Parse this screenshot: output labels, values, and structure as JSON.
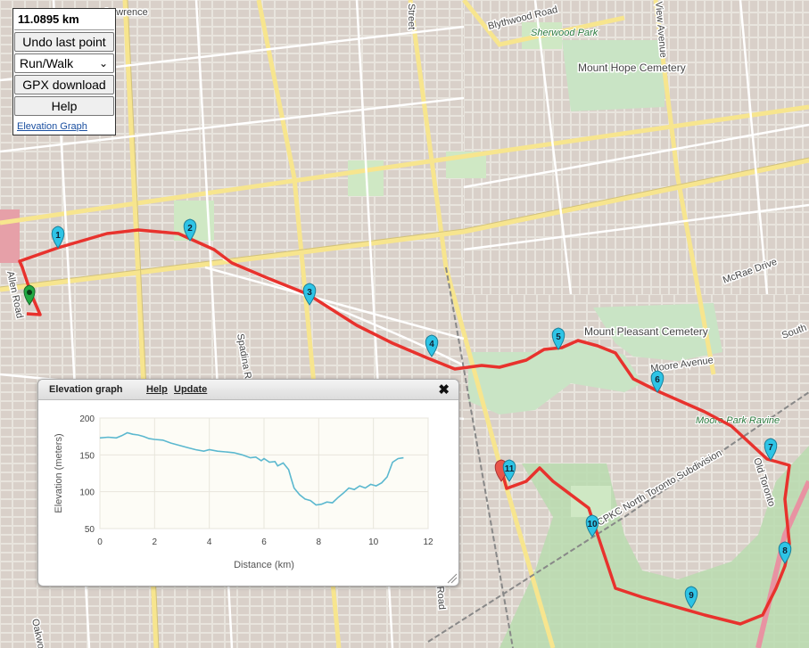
{
  "panel": {
    "distance": "11.0895 km",
    "undo_label": "Undo last point",
    "mode_selected": "Run/Walk",
    "gpx_label": "GPX download",
    "help_label": "Help",
    "elevation_link": "Elevation Graph"
  },
  "map": {
    "street_labels": [
      "Blythwood Road",
      "Spadina Road",
      "Allen Road",
      "McRae Drive",
      "Moore Avenue",
      "CPKC North Toronto Subdivision",
      "Oakwood",
      "Old Toronto",
      "South"
    ],
    "park_labels": [
      "Sherwood Park",
      "Mount Hope Cemetery",
      "Mount Pleasant Cemetery",
      "Moore Park Ravine"
    ],
    "partial_labels": [
      "Lawrence",
      "Street",
      "View Avenue",
      "Road"
    ],
    "route_color": "#e8322d",
    "pin_color": "#2ec4e6",
    "start_pin_color": "#22aa44",
    "end_pin_color": "#e8554a",
    "markers": [
      "1",
      "2",
      "3",
      "4",
      "5",
      "6",
      "7",
      "8",
      "9",
      "10",
      "11"
    ]
  },
  "elevation_window": {
    "title": "Elevation graph",
    "help_link": "Help",
    "update_link": "Update",
    "close_icon": "close-icon"
  },
  "chart_data": {
    "type": "line",
    "xlabel": "Distance (km)",
    "ylabel": "Elevation (meters)",
    "xlim": [
      0,
      12
    ],
    "ylim": [
      50,
      200
    ],
    "xticks": [
      "0",
      "2",
      "4",
      "6",
      "8",
      "10",
      "12"
    ],
    "yticks": [
      "200",
      "150",
      "100",
      "50"
    ],
    "line_color": "#5bb8cf",
    "x": [
      0,
      0.3,
      0.6,
      0.8,
      1.0,
      1.2,
      1.4,
      1.6,
      1.8,
      2.0,
      2.3,
      2.6,
      2.9,
      3.2,
      3.5,
      3.8,
      4.0,
      4.3,
      4.6,
      4.9,
      5.2,
      5.5,
      5.7,
      5.9,
      6.0,
      6.2,
      6.4,
      6.5,
      6.7,
      6.9,
      7.0,
      7.1,
      7.3,
      7.5,
      7.7,
      7.9,
      8.1,
      8.3,
      8.5,
      8.7,
      8.9,
      9.1,
      9.3,
      9.5,
      9.7,
      9.9,
      10.1,
      10.3,
      10.5,
      10.7,
      10.9,
      11.1
    ],
    "y": [
      173,
      174,
      173,
      176,
      180,
      178,
      177,
      175,
      172,
      171,
      170,
      166,
      163,
      160,
      157,
      155,
      157,
      155,
      154,
      153,
      150,
      146,
      147,
      142,
      145,
      140,
      141,
      135,
      139,
      130,
      117,
      105,
      96,
      90,
      88,
      82,
      83,
      86,
      85,
      92,
      98,
      105,
      103,
      108,
      105,
      110,
      108,
      112,
      120,
      140,
      145,
      146
    ]
  }
}
